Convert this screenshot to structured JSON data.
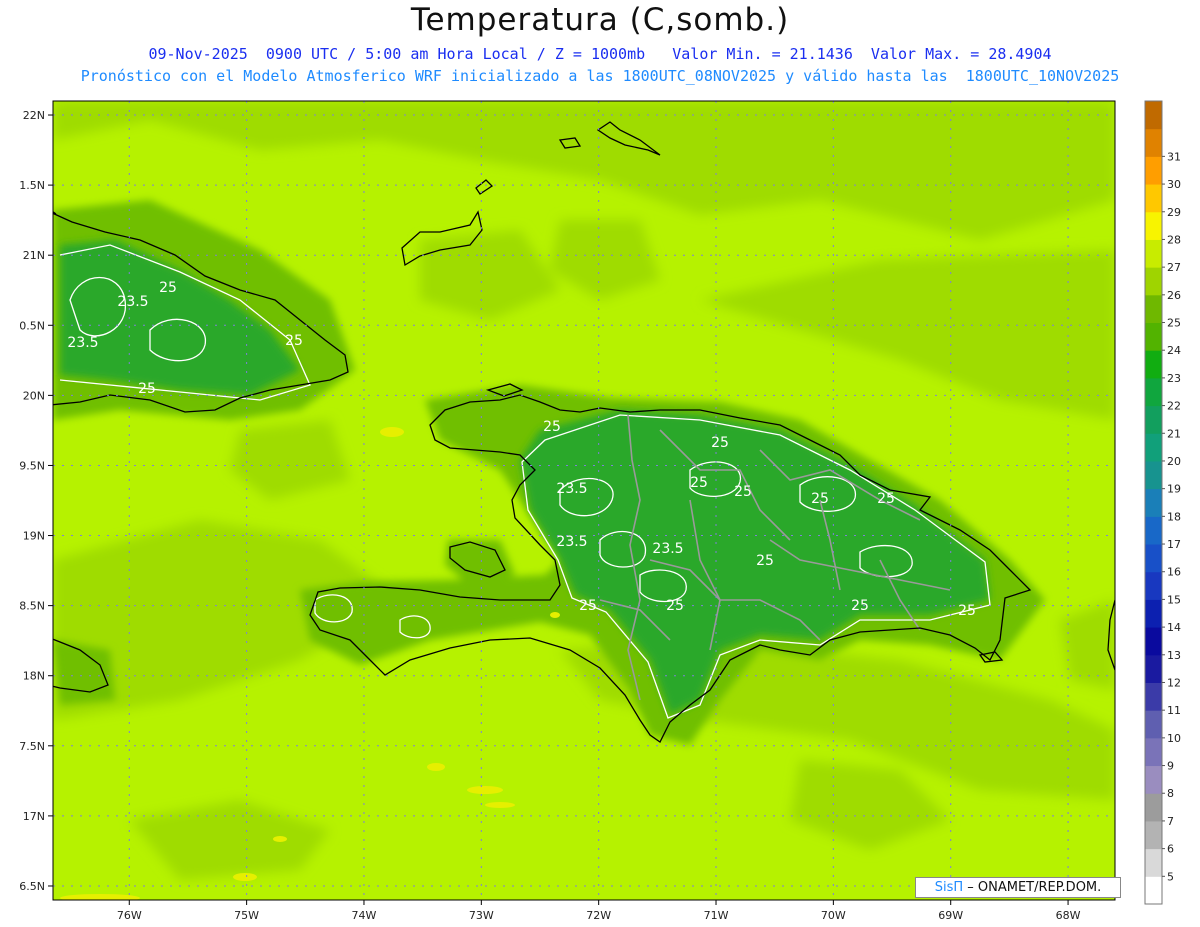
{
  "header": {
    "title": "Temperatura (C,somb.)",
    "subtitle_line1": "09-Nov-2025  0900 UTC / 5:00 am Hora Local / Z = 1000mb   Valor Min. = 21.1436  Valor Max. = 28.4904",
    "subtitle_line2": "Pronóstico con el Modelo Atmosferico WRF inicializado a las 1800UTC_08NOV2025 y válido hasta las  1800UTC_10NOV2025"
  },
  "axes": {
    "lon_labels": [
      "76W",
      "75W",
      "74W",
      "73W",
      "72W",
      "71W",
      "70W",
      "69W",
      "68W"
    ],
    "lon_values": [
      -76,
      -75,
      -74,
      -73,
      -72,
      -71,
      -70,
      -69,
      -68
    ],
    "lat_labels": [
      "22N",
      "1.5N",
      "21N",
      "0.5N",
      "20N",
      "9.5N",
      "19N",
      "8.5N",
      "18N",
      "7.5N",
      "17N",
      "6.5N"
    ],
    "lat_values": [
      22,
      21.5,
      21,
      20.5,
      20,
      19.5,
      19,
      18.5,
      18,
      17.5,
      17,
      16.5
    ],
    "lon_range": [
      -76.65,
      -67.6
    ],
    "lat_range": [
      16.4,
      22.1
    ]
  },
  "colorbar": {
    "labels": [
      "5",
      "6",
      "7",
      "8",
      "9",
      "10",
      "11",
      "12",
      "13",
      "14",
      "15",
      "16",
      "17",
      "18",
      "19",
      "20",
      "21",
      "22",
      "23",
      "24",
      "25",
      "26",
      "27",
      "28",
      "29",
      "30",
      "31"
    ],
    "colors": [
      "#ffffff",
      "#d9d9d9",
      "#b3b3b3",
      "#9c9c9c",
      "#9a8dbf",
      "#7a73b8",
      "#5f5fb0",
      "#3b3ba8",
      "#1a1aa0",
      "#0a0a9e",
      "#0c20b0",
      "#1838c0",
      "#1850c8",
      "#1868c8",
      "#1a7fb8",
      "#17938f",
      "#11a07a",
      "#129f5e",
      "#10a63e",
      "#11ad11",
      "#52b300",
      "#6fb800",
      "#9fd400",
      "#c8ec00",
      "#f8f400",
      "#ffc800",
      "#ff9e00",
      "#e08200",
      "#c06a00"
    ]
  },
  "contour_labels": [
    "25",
    "23.5",
    "25",
    "23.5",
    "25",
    "25",
    "25",
    "23.5",
    "25",
    "25",
    "25",
    "25",
    "23.5",
    "23.5",
    "25",
    "25",
    "25",
    "25",
    "25"
  ],
  "credit": {
    "brand": "SisΠ",
    "text": " – ONAMET/REP.DOM."
  },
  "colors": {
    "sea_warm": "#b6f200",
    "sea_mid": "#9fdc00",
    "land_cool": "#70bf00",
    "land_coolest": "#2ca82c",
    "coast": "#000000",
    "grid": "#7f7fd9"
  }
}
